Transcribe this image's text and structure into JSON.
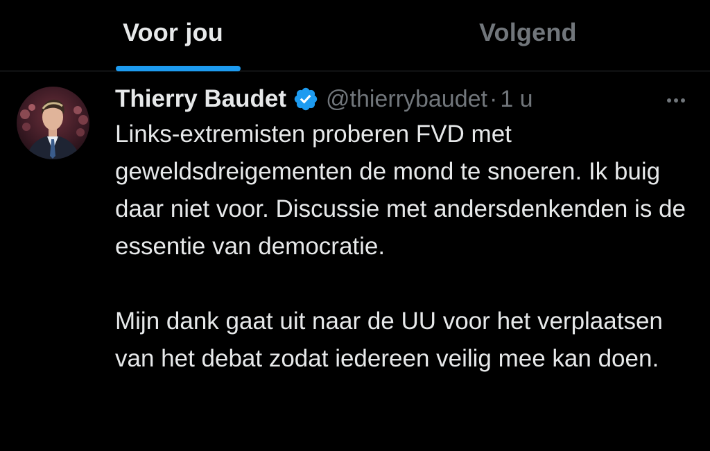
{
  "tabs": [
    {
      "label": "Voor jou",
      "active": true
    },
    {
      "label": "Volgend",
      "active": false
    }
  ],
  "colors": {
    "background": "#000000",
    "text_primary": "#e7e9ea",
    "text_secondary": "#71767b",
    "accent": "#1d9bf0",
    "divider": "#2f3336"
  },
  "tweet": {
    "author": {
      "display_name": "Thierry Baudet",
      "handle": "@thierrybaudet",
      "verified": true,
      "avatar_icon": "profile-photo"
    },
    "separator": "·",
    "time": "1 u",
    "more_icon": "more-horizontal-icon",
    "paragraphs": [
      "Links-extremisten proberen FVD met geweldsdreigementen de mond te snoeren. Ik buig daar niet voor. Discussie met andersdenkenden is de essentie van democratie.",
      "Mijn dank gaat uit naar de UU voor het verplaatsen van het debat zodat iedereen veilig mee kan doen."
    ]
  }
}
